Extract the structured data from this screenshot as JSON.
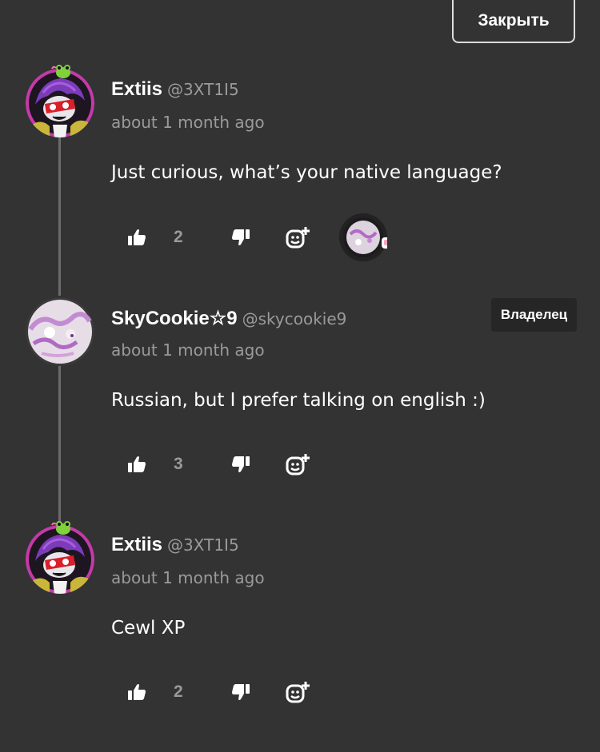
{
  "header": {
    "close_label": "Закрыть"
  },
  "comments": [
    {
      "display_name": "Extiis",
      "handle": "@3XT1I5",
      "timestamp": "about 1 month ago",
      "text": "Just curious, what’s your native language?",
      "likes": "2",
      "has_reaction": true
    },
    {
      "display_name": "SkyCookie☆9",
      "handle": "@skycookie9",
      "timestamp": "about 1 month ago",
      "text": "Russian, but I prefer talking on english :)",
      "likes": "3",
      "badge": "Владелец"
    },
    {
      "display_name": "Extiis",
      "handle": "@3XT1I5",
      "timestamp": "about 1 month ago",
      "text": "Cewl XP",
      "likes": "2"
    }
  ],
  "colors": {
    "background": "#333333",
    "text_primary": "#ffffff",
    "text_secondary": "#9a9a9a",
    "thread_line": "#6b6b6b",
    "badge_bg": "#262626",
    "avatar_ring": "#c43aa8"
  },
  "icons": {
    "like": "thumbs-up-icon",
    "dislike": "thumbs-down-icon",
    "react": "add-emoji-icon"
  }
}
